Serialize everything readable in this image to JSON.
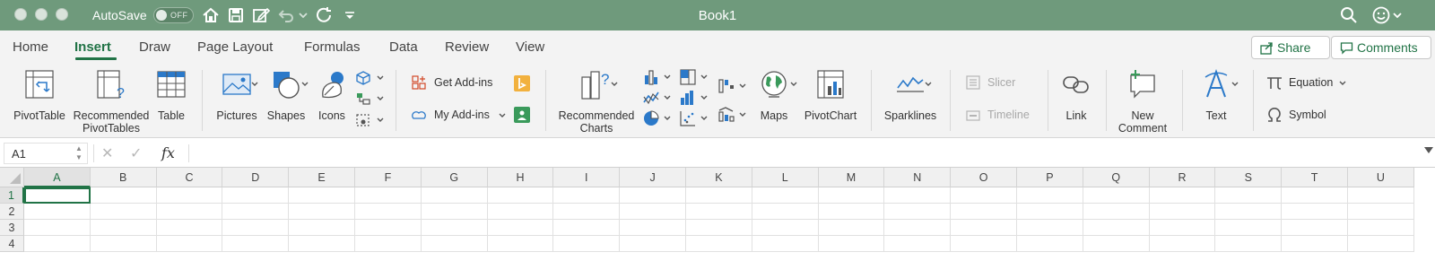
{
  "titlebar": {
    "autosave_label": "AutoSave",
    "autosave_state": "OFF",
    "title": "Book1",
    "accent_color": "#6f9a7c"
  },
  "tabs": [
    "Home",
    "Insert",
    "Draw",
    "Page Layout",
    "Formulas",
    "Data",
    "Review",
    "View"
  ],
  "active_tab": "Insert",
  "actions": {
    "share": "Share",
    "comments": "Comments"
  },
  "ribbon": {
    "pivottable": "PivotTable",
    "recommended_pivottables_1": "Recommended",
    "recommended_pivottables_2": "PivotTables",
    "table": "Table",
    "pictures": "Pictures",
    "shapes": "Shapes",
    "icons": "Icons",
    "get_addins": "Get Add-ins",
    "my_addins": "My Add-ins",
    "recommended_charts_1": "Recommended",
    "recommended_charts_2": "Charts",
    "maps": "Maps",
    "pivotchart": "PivotChart",
    "sparklines": "Sparklines",
    "slicer": "Slicer",
    "timeline": "Timeline",
    "link": "Link",
    "new_comment_1": "New",
    "new_comment_2": "Comment",
    "text": "Text",
    "equation": "Equation",
    "symbol": "Symbol"
  },
  "formula_bar": {
    "name_box": "A1",
    "fx": "fx",
    "value": ""
  },
  "grid": {
    "columns": [
      "A",
      "B",
      "C",
      "D",
      "E",
      "F",
      "G",
      "H",
      "I",
      "J",
      "K",
      "L",
      "M",
      "N",
      "O",
      "P",
      "Q",
      "R",
      "S",
      "T",
      "U"
    ],
    "rows": [
      "1",
      "2",
      "3",
      "4"
    ],
    "active_cell": "A1"
  }
}
